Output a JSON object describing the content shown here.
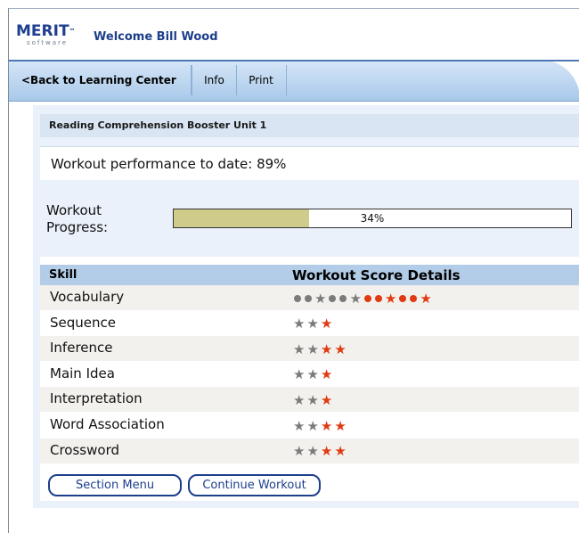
{
  "header": {
    "logo_text": "MERIT",
    "logo_sub": "software",
    "welcome": "Welcome Bill Wood"
  },
  "nav": {
    "back_label": "<Back to Learning Center",
    "info_label": "Info",
    "print_label": "Print"
  },
  "unit": {
    "title": "Reading Comprehension Booster Unit 1",
    "performance_text": "Workout performance to date: 89%"
  },
  "progress": {
    "label": "Workout Progress:",
    "value_text": "34%",
    "fraction": 0.34
  },
  "table": {
    "col_skill": "Skill",
    "col_score": "Workout Score Details",
    "rows": [
      {
        "name": "Vocabulary",
        "marks": [
          "gdot",
          "gdot",
          "gstar",
          "gdot",
          "gdot",
          "gstar",
          "rdot",
          "rdot",
          "rstar",
          "rdot",
          "rdot",
          "rstar"
        ]
      },
      {
        "name": "Sequence",
        "marks": [
          "gstar",
          "gstar",
          "rstar"
        ]
      },
      {
        "name": "Inference",
        "marks": [
          "gstar",
          "gstar",
          "rstar",
          "rstar"
        ]
      },
      {
        "name": "Main Idea",
        "marks": [
          "gstar",
          "gstar",
          "rstar"
        ]
      },
      {
        "name": "Interpretation",
        "marks": [
          "gstar",
          "gstar",
          "rstar"
        ]
      },
      {
        "name": "Word Association",
        "marks": [
          "gstar",
          "gstar",
          "rstar",
          "rstar"
        ]
      },
      {
        "name": "Crossword",
        "marks": [
          "gstar",
          "gstar",
          "rstar",
          "rstar"
        ]
      }
    ]
  },
  "buttons": {
    "section_menu": "Section Menu",
    "continue_workout": "Continue Workout"
  },
  "colors": {
    "brand_blue": "#1c3f8a",
    "progress_fill": "#cfcb8a",
    "mark_grey": "#7b7b7b",
    "mark_red": "#e03a12",
    "table_header": "#b3cde8"
  }
}
